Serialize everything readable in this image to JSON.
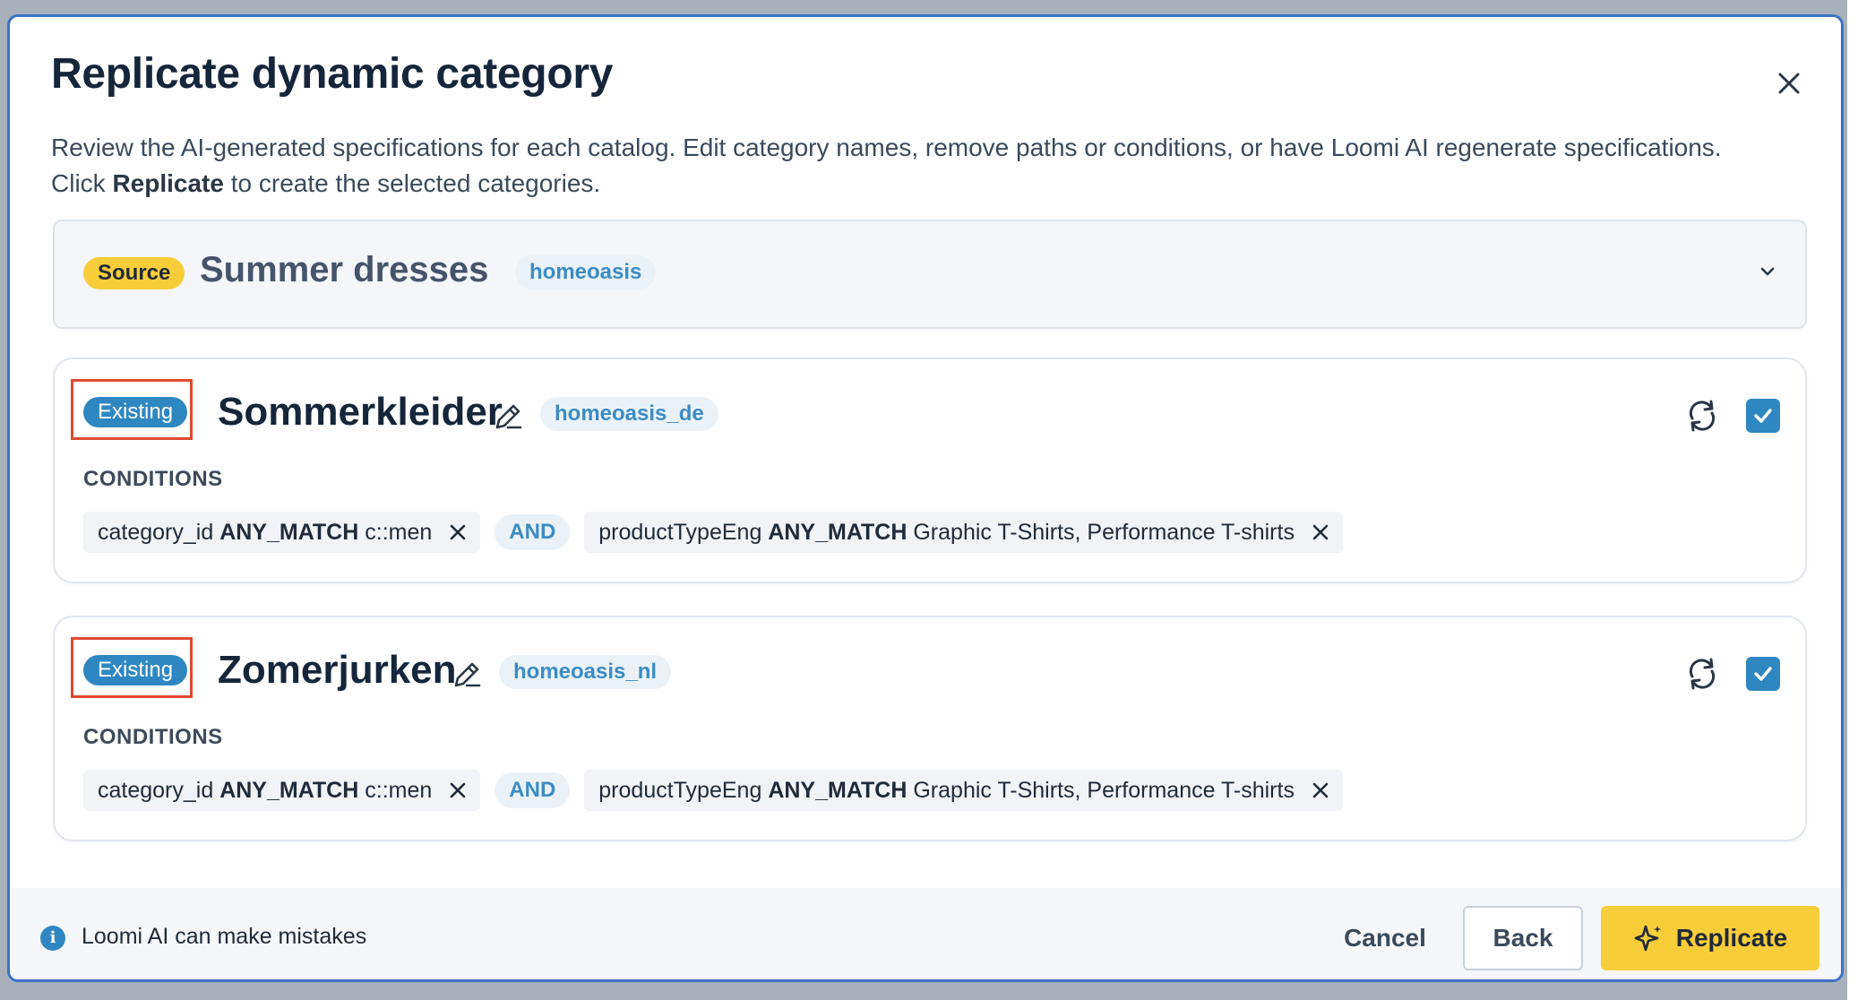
{
  "dialog": {
    "title": "Replicate dynamic category",
    "description_part1": "Review the AI-generated specifications for each catalog. Edit category names, remove paths or conditions, or have Loomi AI regenerate specifications. Click ",
    "description_bold": "Replicate",
    "description_part2": " to create the selected categories."
  },
  "source": {
    "badge": "Source",
    "name": "Summer dresses",
    "catalog": "homeoasis"
  },
  "categories": [
    {
      "badge": "Existing",
      "name": "Sommerkleider",
      "catalog": "homeoasis_de",
      "selected": true,
      "conditions_label": "CONDITIONS",
      "conditions": [
        {
          "field": "category_id",
          "operator": "ANY_MATCH",
          "value": "c::men"
        },
        {
          "field": "productTypeEng",
          "operator": "ANY_MATCH",
          "value": "Graphic T-Shirts, Performance T-shirts"
        }
      ],
      "joiner": "AND"
    },
    {
      "badge": "Existing",
      "name": "Zomerjurken",
      "catalog": "homeoasis_nl",
      "selected": true,
      "conditions_label": "CONDITIONS",
      "conditions": [
        {
          "field": "category_id",
          "operator": "ANY_MATCH",
          "value": "c::men"
        },
        {
          "field": "productTypeEng",
          "operator": "ANY_MATCH",
          "value": "Graphic T-Shirts, Performance T-shirts"
        }
      ],
      "joiner": "AND"
    }
  ],
  "footer": {
    "note": "Loomi AI can make mistakes",
    "cancel_label": "Cancel",
    "back_label": "Back",
    "replicate_label": "Replicate"
  },
  "colors": {
    "accent_blue": "#2f87c2",
    "accent_yellow": "#f8cd3a",
    "highlight_red": "#e04a31",
    "modal_border": "#3b72c5"
  }
}
